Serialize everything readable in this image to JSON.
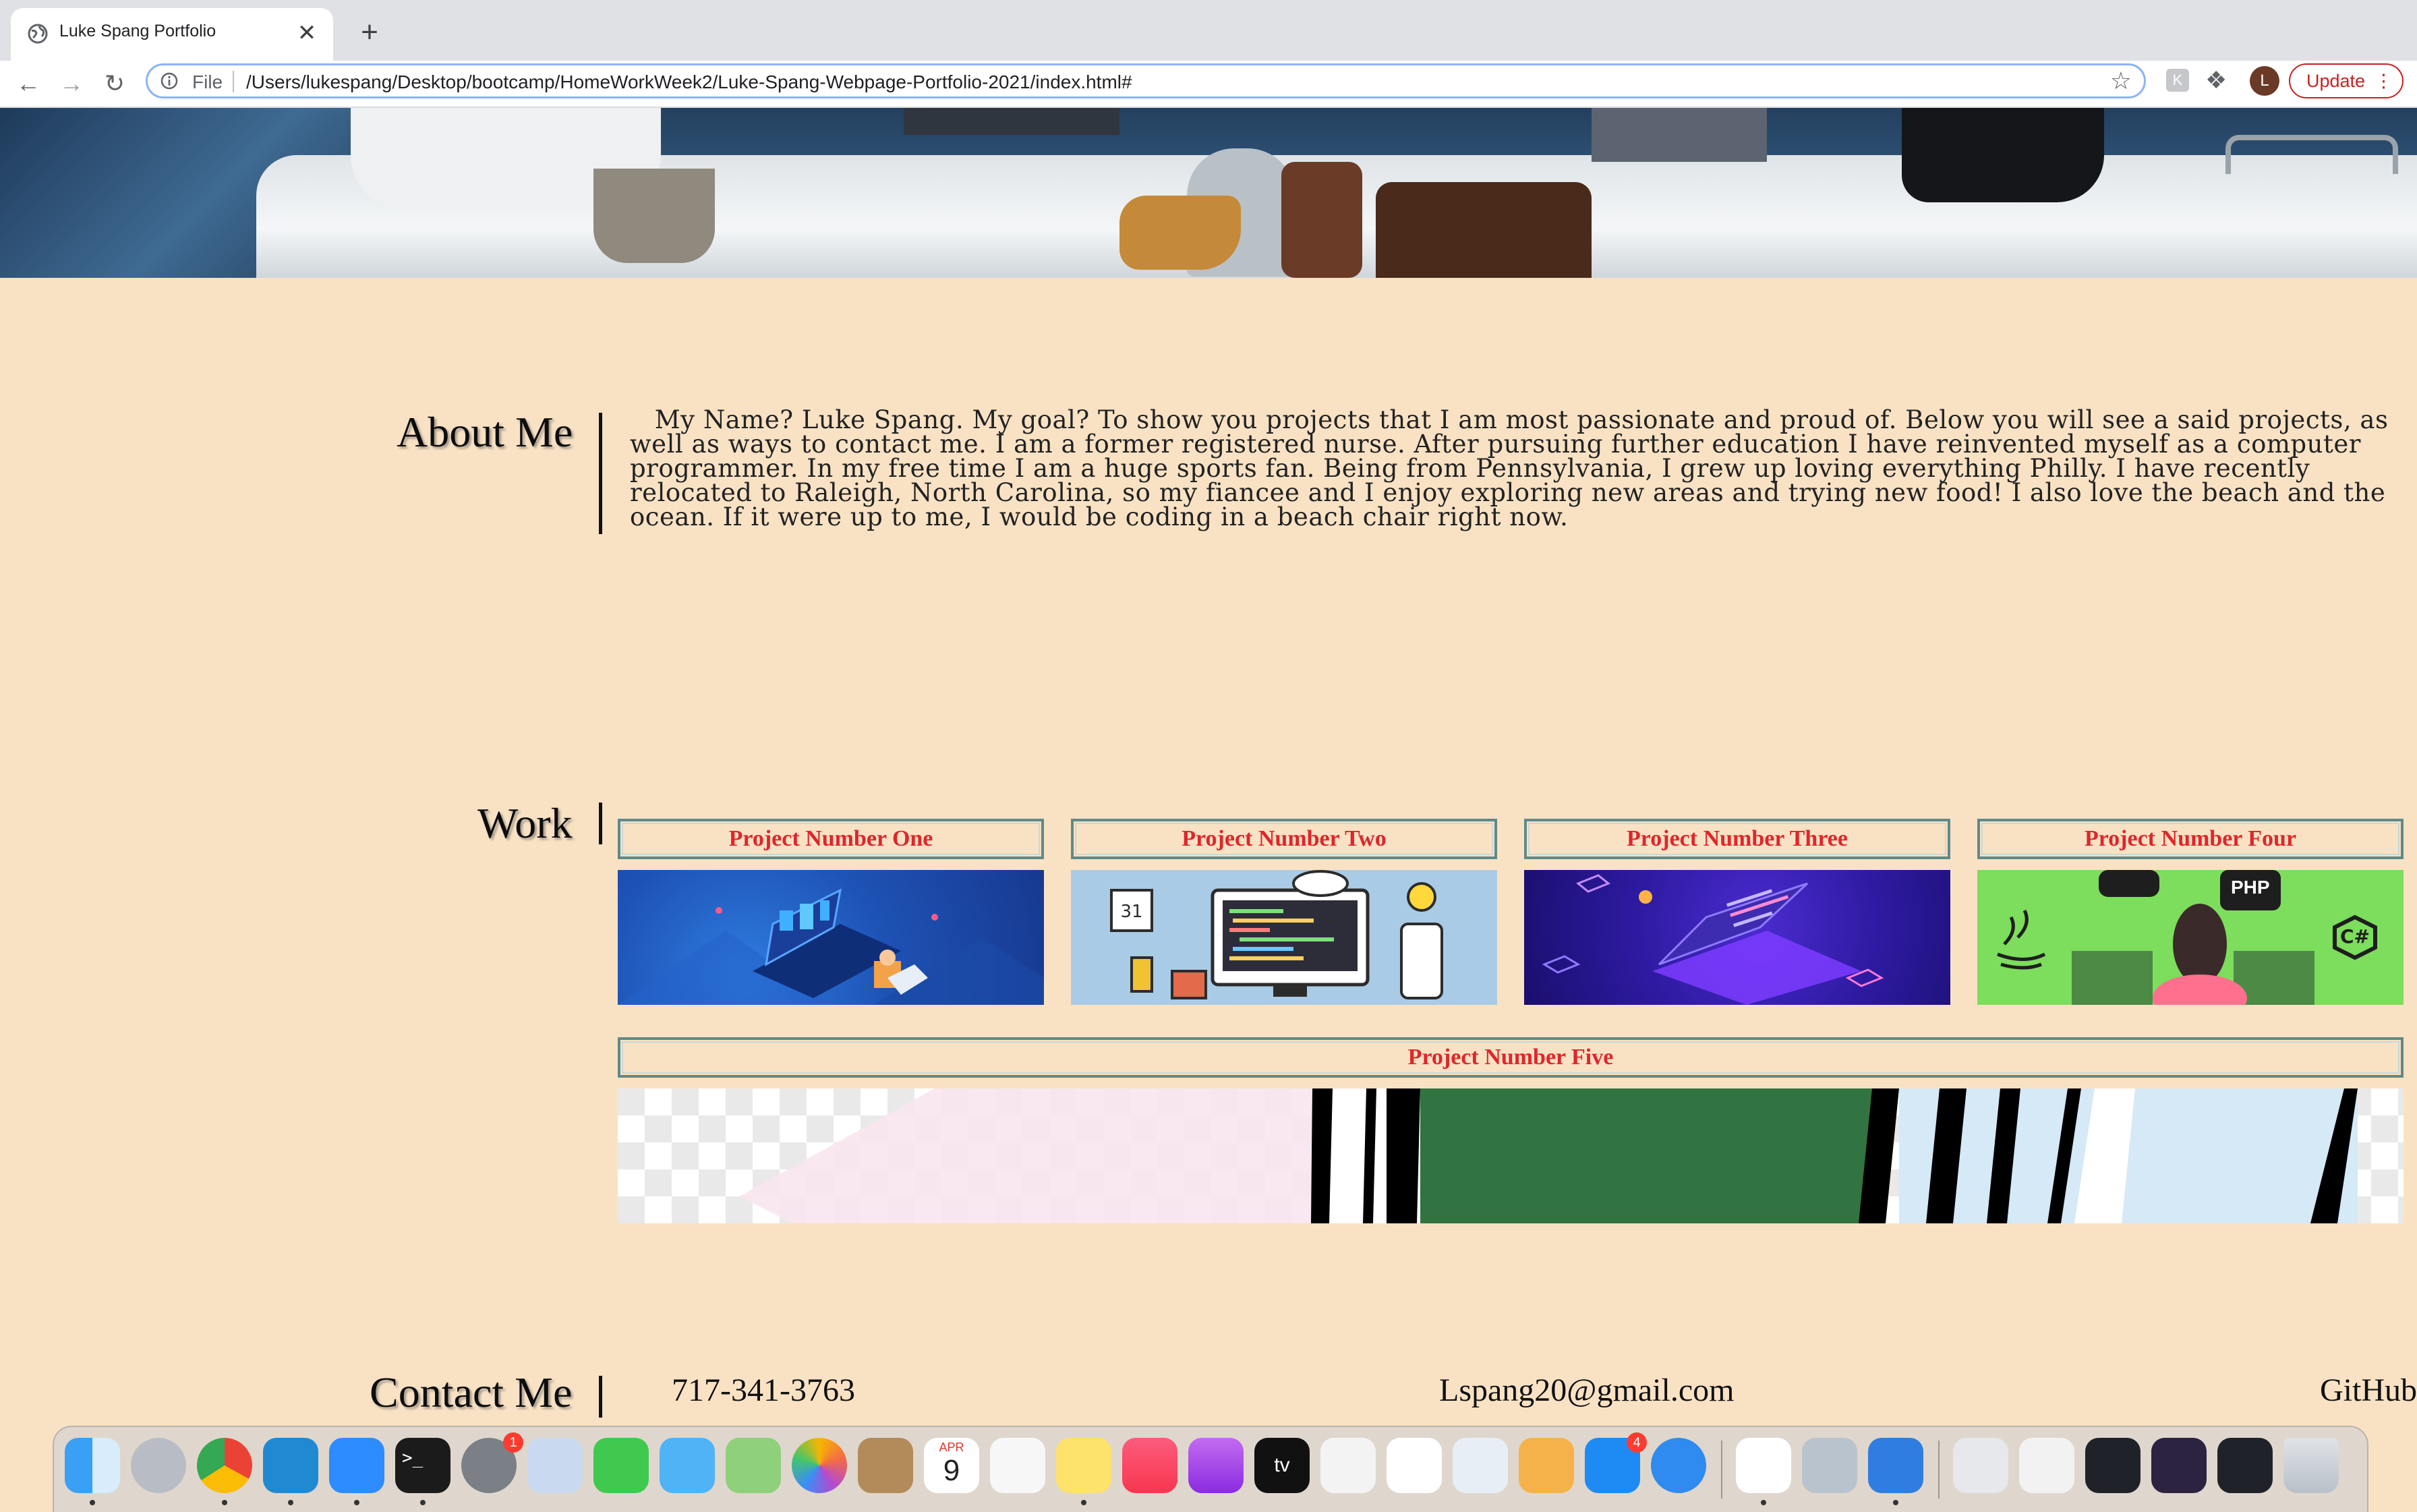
{
  "browser": {
    "tab_title": "Luke Spang Portfolio",
    "tab_close": "✕",
    "new_tab": "+",
    "omnibox_scheme": "File",
    "url": "/Users/lukespang/Desktop/bootcamp/HomeWorkWeek2/Luke-Spang-Webpage-Portfolio-2021/index.html#",
    "profile_initial": "L",
    "update_label": "Update",
    "menu_dots": "⋮"
  },
  "about": {
    "heading": "About Me",
    "text": "My Name? Luke Spang. My goal? To show you projects that I am most passionate and proud of. Below you will see a said projects, as well as ways to contact me. I am a former registered nurse. After pursuing further education I have reinvented myself as a computer programmer. In my free time I am a huge sports fan. Being from Pennsylvania, I grew up loving everything Philly. I have recently relocated to Raleigh, North Carolina, so my fiancee and I enjoy exploring new areas and trying new food! I also love the beach and the ocean. If it were up to me, I would be coding in a beach chair right now."
  },
  "work": {
    "heading": "Work",
    "projects": [
      {
        "label": "Project Number One",
        "image": "isometric-laptop-illustration"
      },
      {
        "label": "Project Number Two",
        "image": "developer-desk-illustration"
      },
      {
        "label": "Project Number Three",
        "image": "purple-laptop-illustration"
      },
      {
        "label": "Project Number Four",
        "image": "programming-languages-illustration"
      },
      {
        "label": "Project Number Five",
        "image": "abstract-stripes-image"
      }
    ],
    "php_label": "PHP"
  },
  "contact": {
    "heading": "Contact Me",
    "phone": "717-341-3763",
    "email": "Lspang20@gmail.com",
    "github": "GitHub"
  },
  "dock": {
    "apps": [
      "finder",
      "launchpad",
      "chrome",
      "vscode",
      "zoom",
      "terminal",
      "system-preferences",
      "preview",
      "facetime",
      "messages",
      "maps",
      "photos",
      "contacts",
      "calendar",
      "reminders",
      "notes",
      "music",
      "podcasts",
      "tv",
      "news",
      "numbers",
      "keynote",
      "pages",
      "app-store",
      "safari",
      "slack",
      "image-capture",
      "xcode",
      "window-1",
      "window-2",
      "window-3",
      "window-4",
      "window-5",
      "trash"
    ],
    "calendar_month": "APR",
    "calendar_day": "9",
    "badge_system_preferences": "1",
    "badge_app_store": "4",
    "tv_label": "tv",
    "terminal_prompt": ">_"
  },
  "colors": {
    "page_bg": "#f9e2c4",
    "project_label_text": "#e0262b",
    "project_border": "#5f8a8b",
    "accent_blue": "#8ab4f8",
    "update_red": "#c5221f"
  }
}
